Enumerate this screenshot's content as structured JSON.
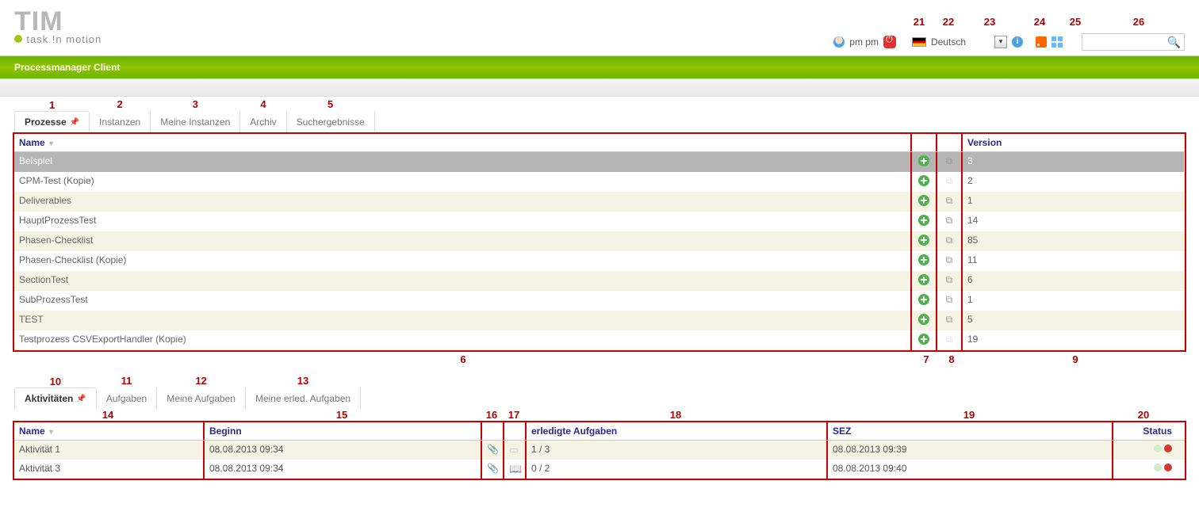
{
  "logo": {
    "big": "TIM",
    "sub": "task !n motion"
  },
  "greenbar_title": "Processmanager Client",
  "header": {
    "user_label": "pm pm",
    "lang_label": "Deutsch",
    "annotations": {
      "a21": "21",
      "a22": "22",
      "a23": "23",
      "a24": "24",
      "a25": "25",
      "a26": "26"
    }
  },
  "top_tabs": [
    {
      "label": "Prozesse",
      "active": true,
      "pin": true,
      "ann": "1"
    },
    {
      "label": "Instanzen",
      "ann": "2"
    },
    {
      "label": "Meine Instanzen",
      "ann": "3"
    },
    {
      "label": "Archiv",
      "ann": "4"
    },
    {
      "label": "Suchergebnisse",
      "ann": "5"
    }
  ],
  "process_table": {
    "headers": {
      "name": "Name",
      "version": "Version"
    },
    "rows": [
      {
        "name": "Beispiel",
        "version": "3",
        "selected": true,
        "play": true
      },
      {
        "name": "CPM-Test (Kopie)",
        "version": "2",
        "play": false
      },
      {
        "name": "Deliverables",
        "version": "1",
        "play": true
      },
      {
        "name": "HauptProzessTest",
        "version": "14",
        "play": true
      },
      {
        "name": "Phasen-Checklist",
        "version": "85",
        "play": true
      },
      {
        "name": "Phasen-Checklist (Kopie)",
        "version": "11",
        "play": true
      },
      {
        "name": "SectionTest",
        "version": "6",
        "play": true
      },
      {
        "name": "SubProzessTest",
        "version": "1",
        "play": true
      },
      {
        "name": "TEST",
        "version": "5",
        "play": true
      },
      {
        "name": "Testprozess CSVExportHandler (Kopie)",
        "version": "19",
        "play": false
      }
    ],
    "annotations": {
      "a6": "6",
      "a7": "7",
      "a8": "8",
      "a9": "9"
    }
  },
  "bottom_tabs": [
    {
      "label": "Aktivitäten",
      "active": true,
      "pin": true,
      "ann": "10"
    },
    {
      "label": "Aufgaben",
      "ann": "11"
    },
    {
      "label": "Meine Aufgaben",
      "ann": "12"
    },
    {
      "label": "Meine erled. Aufgaben",
      "ann": "13"
    }
  ],
  "activity_table": {
    "headers": {
      "name": "Name",
      "beginn": "Beginn",
      "erledigt": "erledigte Aufgaben",
      "sez": "SEZ",
      "status": "Status"
    },
    "annotations": {
      "a14": "14",
      "a15": "15",
      "a16": "16",
      "a17": "17",
      "a18": "18",
      "a19": "19",
      "a20": "20"
    },
    "rows": [
      {
        "name": "Aktivität 1",
        "beginn": "08.08.2013 09:34",
        "erledigt": "1 / 3",
        "sez": "08.08.2013 09:39",
        "book": false
      },
      {
        "name": "Aktivität 3",
        "beginn": "08.08.2013 09:34",
        "erledigt": "0 / 2",
        "sez": "08.08.2013 09:40",
        "book": true
      }
    ]
  }
}
